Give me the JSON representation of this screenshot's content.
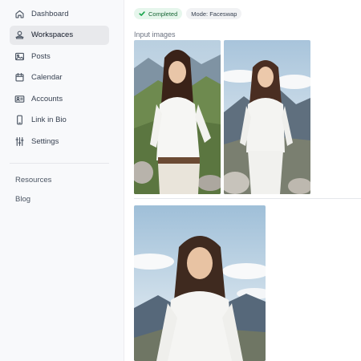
{
  "sidebar": {
    "items": [
      {
        "label": "Dashboard",
        "icon": "home-icon",
        "active": false
      },
      {
        "label": "Workspaces",
        "icon": "user-icon",
        "active": true
      },
      {
        "label": "Posts",
        "icon": "image-icon",
        "active": false
      },
      {
        "label": "Calendar",
        "icon": "calendar-icon",
        "active": false
      },
      {
        "label": "Accounts",
        "icon": "id-card-icon",
        "active": false
      },
      {
        "label": "Link in Bio",
        "icon": "phone-icon",
        "active": false
      },
      {
        "label": "Settings",
        "icon": "sliders-icon",
        "active": false
      }
    ],
    "secondary": [
      {
        "label": "Resources"
      },
      {
        "label": "Blog"
      }
    ]
  },
  "main": {
    "status_badge": "Completed",
    "mode_badge": "Mode: Faceswap",
    "input_label": "Input images",
    "input_images": [
      {
        "description": "woman-white-shirt-mountains-1"
      },
      {
        "description": "woman-white-shirt-mountains-2"
      }
    ],
    "result_image": {
      "description": "faceswap-result"
    }
  },
  "colors": {
    "sidebar_bg": "#f8f9fb",
    "active_item_bg": "#e8e9ec",
    "success_bg": "#e6f6ec",
    "success_text": "#166534",
    "badge_bg": "#f1f2f4"
  }
}
